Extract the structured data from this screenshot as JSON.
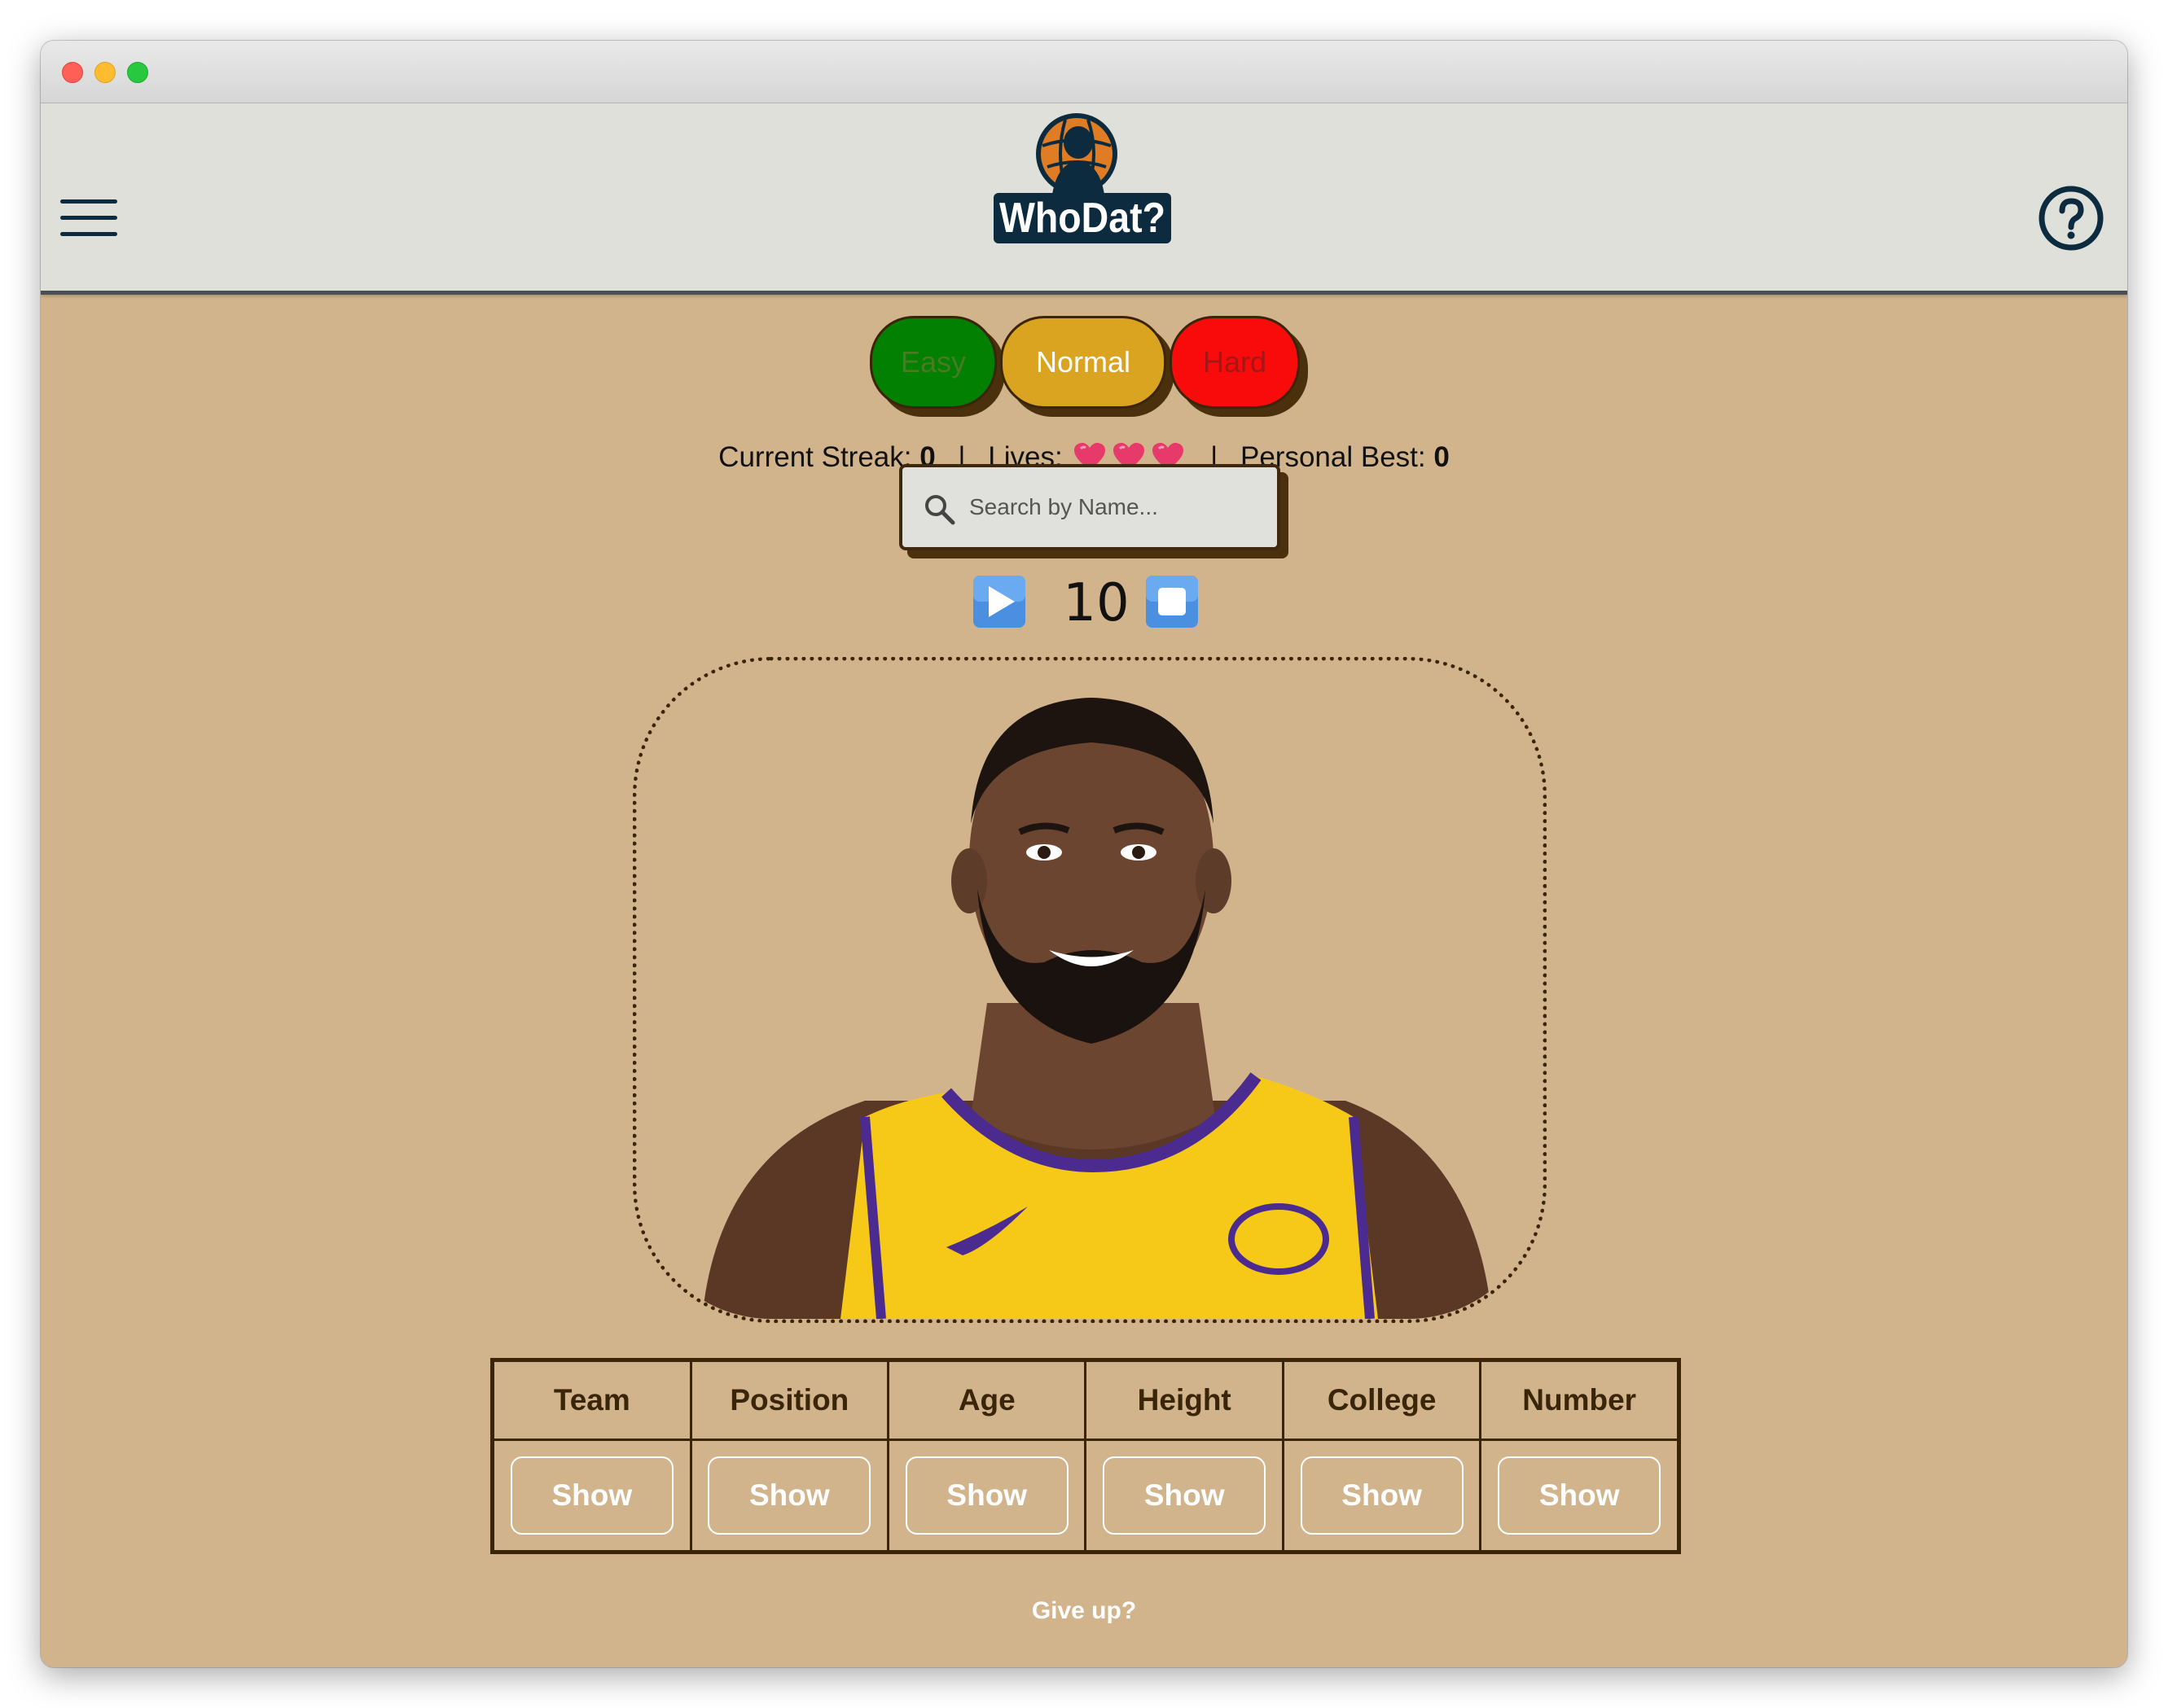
{
  "header": {
    "logo_text": "WhoDat?",
    "menu_icon": "hamburger-menu-icon",
    "help_icon": "question-circle-icon"
  },
  "difficulty": {
    "easy": "Easy",
    "normal": "Normal",
    "hard": "Hard",
    "selected": "Normal",
    "colors": {
      "easy": "#018001",
      "normal": "#daa420",
      "hard": "#f90b0b"
    }
  },
  "stats": {
    "streak_label": "Current Streak:",
    "streak_value": "0",
    "lives_label": "Lives:",
    "lives": 3,
    "best_label": "Personal Best:",
    "best_value": "0"
  },
  "search": {
    "placeholder": "Search by Name..."
  },
  "timer": {
    "value": "10",
    "play_icon": "play-icon",
    "stop_icon": "stop-icon"
  },
  "player_image": {
    "alt": "Player headshot"
  },
  "attributes": {
    "headers": [
      "Team",
      "Position",
      "Age",
      "Height",
      "College",
      "Number"
    ],
    "button_label": "Show"
  },
  "give_up": "Give up?",
  "theme": {
    "background": "#d2b48c",
    "header": "#dfe0da",
    "brown": "#3b2509"
  }
}
